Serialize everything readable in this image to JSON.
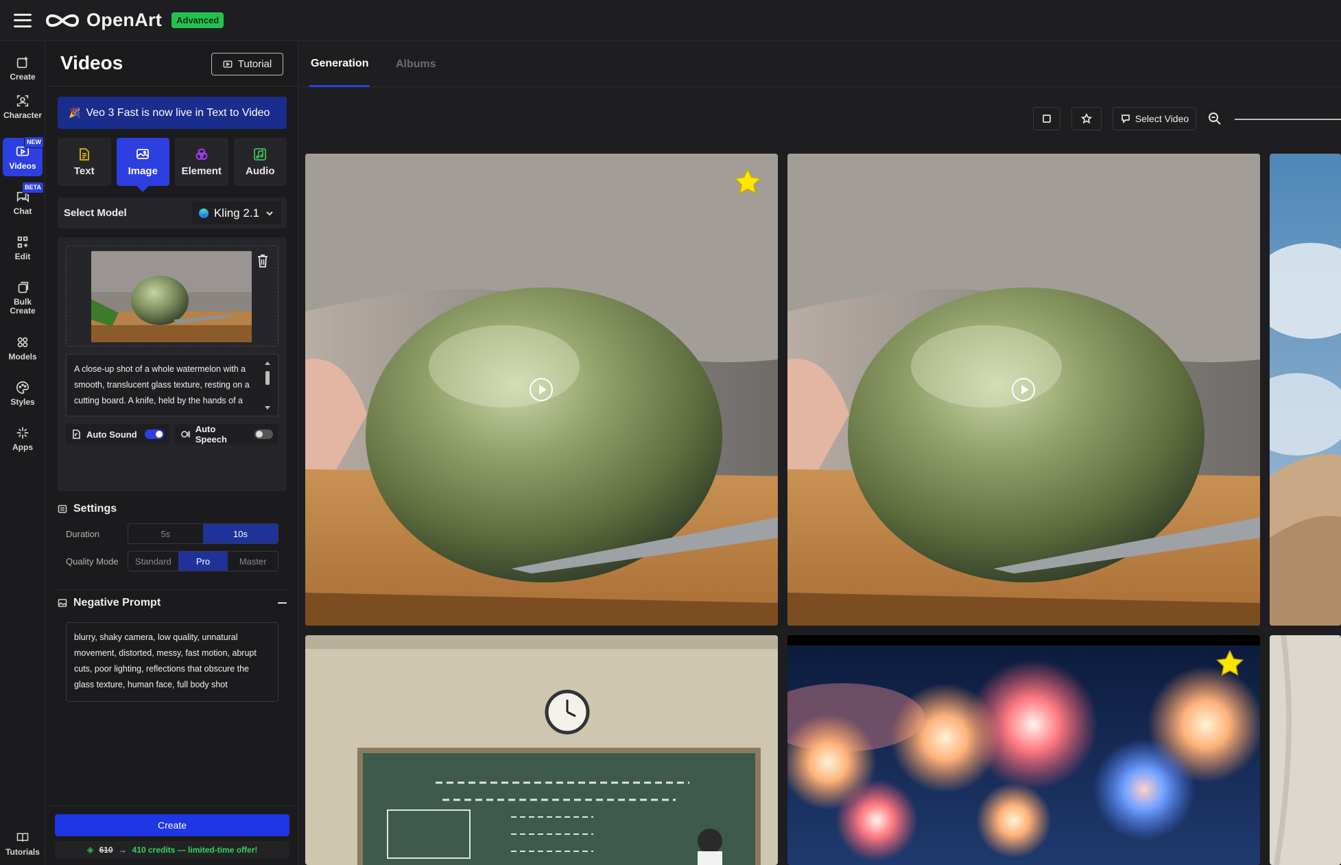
{
  "app": {
    "brand": "OpenArt",
    "plan_badge": "Advanced"
  },
  "rail": {
    "items": [
      {
        "label": "Create",
        "icon": "create-icon"
      },
      {
        "label": "Character",
        "icon": "character-icon"
      },
      {
        "label": "Videos",
        "icon": "video-icon",
        "tag": "NEW",
        "active": true
      },
      {
        "label": "Chat",
        "icon": "chat-icon",
        "tag": "BETA"
      },
      {
        "label": "Edit",
        "icon": "edit-icon"
      },
      {
        "label": "Bulk Create",
        "icon": "bulk-create-icon"
      },
      {
        "label": "Models",
        "icon": "models-icon"
      },
      {
        "label": "Styles",
        "icon": "styles-icon"
      },
      {
        "label": "Apps",
        "icon": "apps-icon"
      }
    ],
    "tutorials_label": "Tutorials"
  },
  "panel": {
    "title": "Videos",
    "tutorial_label": "Tutorial",
    "banner": "Veo 3 Fast is now live in Text to Video",
    "modes": [
      {
        "label": "Text",
        "icon": "text-doc-icon",
        "color": "#e6b800"
      },
      {
        "label": "Image",
        "icon": "image-icon",
        "color": "#ffffff",
        "active": true
      },
      {
        "label": "Element",
        "icon": "element-icon",
        "color": "#b03cff"
      },
      {
        "label": "Audio",
        "icon": "audio-icon",
        "color": "#3fbf5a"
      }
    ],
    "model": {
      "label": "Select Model",
      "value": "Kling 2.1"
    },
    "prompt": "A close-up shot of a whole watermelon with a smooth, translucent glass texture, resting on a cutting board. A knife, held by the hands of a",
    "auto_sound": {
      "label": "Auto Sound",
      "on": true
    },
    "auto_speech": {
      "label": "Auto Speech",
      "on": false
    },
    "settings": {
      "title": "Settings",
      "duration": {
        "label": "Duration",
        "options": [
          "5s",
          "10s"
        ],
        "selected": "10s"
      },
      "quality": {
        "label": "Quality Mode",
        "options": [
          "Standard",
          "Pro",
          "Master"
        ],
        "selected": "Pro"
      }
    },
    "negative_prompt": {
      "title": "Negative Prompt",
      "text": "blurry, shaky camera, low quality, unnatural movement, distorted, messy, fast motion, abrupt cuts, poor lighting, reflections that obscure the glass texture, human face, full body shot"
    },
    "create_label": "Create",
    "credits": {
      "old": "610",
      "offer": "410 credits — limited-time offer!"
    }
  },
  "main": {
    "tabs": [
      {
        "label": "Generation",
        "active": true
      },
      {
        "label": "Albums",
        "active": false
      }
    ],
    "toolbar": {
      "select_video_label": "Select Video"
    },
    "accent_color": "#2d3fe0"
  }
}
